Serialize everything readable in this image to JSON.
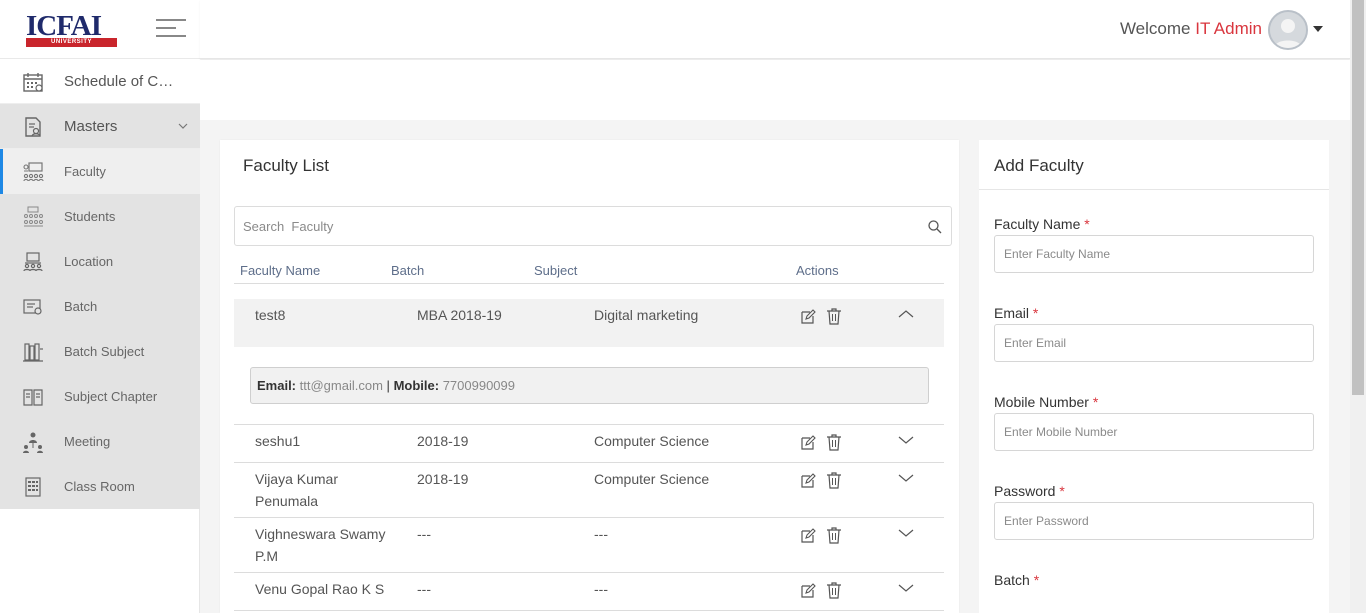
{
  "brand": {
    "logo_text": "ICFAI",
    "logo_subtext": "UNIVERSITY",
    "primary_color": "#1f2a6b",
    "accent_color": "#c9252c"
  },
  "header": {
    "welcome_text": "Welcome",
    "user_name": "IT Admin"
  },
  "sidebar": {
    "items": [
      {
        "label": "Schedule of Cla...",
        "icon": "calendar-icon"
      },
      {
        "label": "Masters",
        "icon": "masters-icon"
      }
    ],
    "masters_sub": [
      {
        "label": "Faculty",
        "icon": "faculty-icon",
        "active": true
      },
      {
        "label": "Students",
        "icon": "students-icon"
      },
      {
        "label": "Location",
        "icon": "location-icon"
      },
      {
        "label": "Batch",
        "icon": "batch-icon"
      },
      {
        "label": "Batch Subject",
        "icon": "batch-subject-icon"
      },
      {
        "label": "Subject Chapter",
        "icon": "subject-chapter-icon"
      },
      {
        "label": "Meeting",
        "icon": "meeting-icon"
      },
      {
        "label": "Class Room",
        "icon": "class-room-icon"
      }
    ]
  },
  "faculty_list": {
    "title": "Faculty List",
    "search_placeholder": "Search  Faculty",
    "columns": [
      "Faculty Name",
      "Batch",
      "Subject",
      "Actions"
    ],
    "rows": [
      {
        "name": "test8",
        "batch": "MBA 2018-19",
        "subject": "Digital marketing",
        "expanded": true
      },
      {
        "name": "seshu1",
        "batch": "2018-19",
        "subject": "Computer Science"
      },
      {
        "name": "Vijaya Kumar Penumala",
        "batch": "2018-19",
        "subject": "Computer Science"
      },
      {
        "name": "Vighneswara Swamy P.M",
        "batch": "---",
        "subject": "---"
      },
      {
        "name": "Venu Gopal Rao K S",
        "batch": "---",
        "subject": "---"
      }
    ],
    "detail": {
      "email_label": "Email:",
      "email": "ttt@gmail.com",
      "separator": "|",
      "mobile_label": "Mobile:",
      "mobile": "7700990099"
    }
  },
  "add_faculty": {
    "title": "Add Faculty",
    "fields": [
      {
        "label": "Faculty Name",
        "placeholder": "Enter Faculty Name",
        "required": "*"
      },
      {
        "label": "Email",
        "placeholder": "Enter Email",
        "required": "*"
      },
      {
        "label": "Mobile Number",
        "placeholder": "Enter Mobile Number",
        "required": "*"
      },
      {
        "label": "Password",
        "placeholder": "Enter Password",
        "required": "*"
      },
      {
        "label": "Batch",
        "required": "*"
      }
    ]
  }
}
